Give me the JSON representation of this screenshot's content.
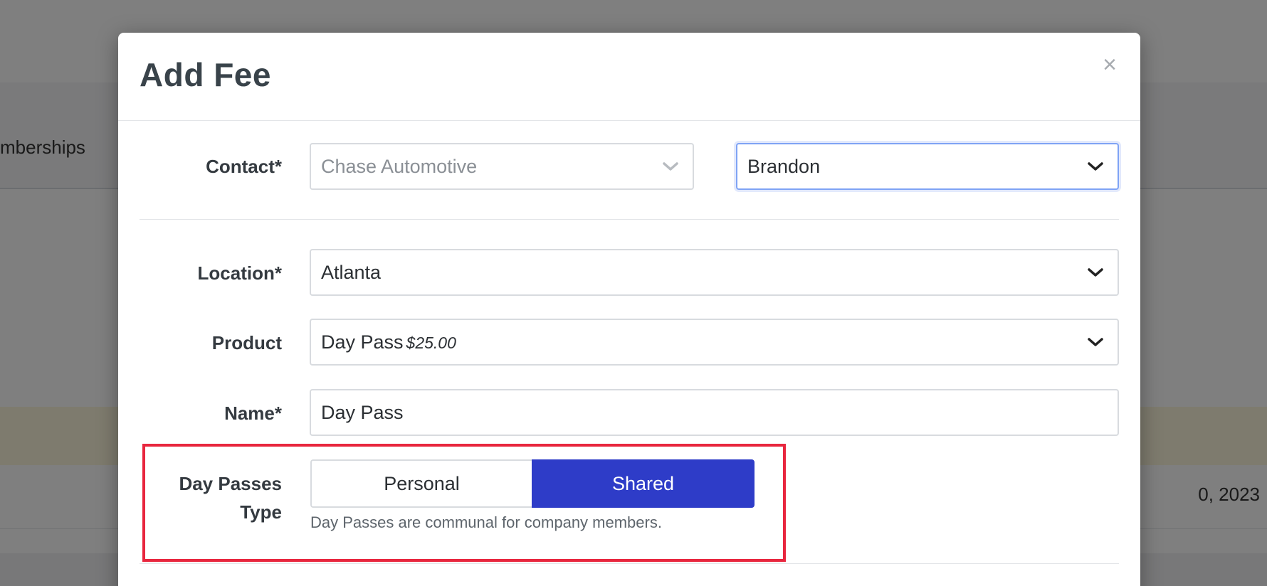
{
  "background": {
    "subnav_item": "mberships",
    "row_date": "0, 2023"
  },
  "modal": {
    "title": "Add Fee",
    "close_symbol": "×"
  },
  "form": {
    "contact": {
      "label": "Contact*",
      "company_value": "Chase Automotive",
      "person_value": "Brandon"
    },
    "location": {
      "label": "Location*",
      "value": "Atlanta"
    },
    "product": {
      "label": "Product",
      "value": "Day Pass",
      "price": "$25.00"
    },
    "name": {
      "label": "Name*",
      "value": "Day Pass"
    },
    "day_passes_type": {
      "label_line1": "Day Passes",
      "label_line2": "Type",
      "options": [
        "Personal",
        "Shared"
      ],
      "selected": "Shared",
      "help_text": "Day Passes are communal for company members."
    }
  },
  "colors": {
    "accent": "#2e3cc8",
    "highlight_border": "#e8263e",
    "focus_border": "#7fa3f5"
  }
}
